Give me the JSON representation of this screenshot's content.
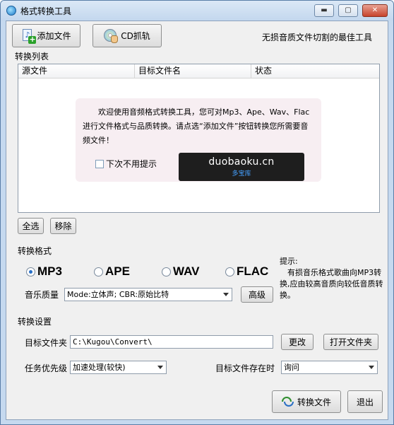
{
  "window": {
    "title": "格式转换工具",
    "controls": {
      "minimize": "▬",
      "maximize": "▢",
      "close": "✕"
    }
  },
  "toolbar": {
    "add_file_label": "添加文件",
    "cd_rip_label": "CD抓轨",
    "slogan": "无损音质文件切割的最佳工具"
  },
  "list": {
    "section_label": "转换列表",
    "columns": [
      "源文件",
      "目标文件名",
      "状态"
    ]
  },
  "welcome": {
    "message": "欢迎使用音频格式转换工具，您可对Mp3、Ape、Wav、Flac进行文件格式与品质转换。请点选“添加文件”按钮转换您所需要音频文件！",
    "dont_show_label": "下次不用提示",
    "dont_show_checked": false
  },
  "watermark": {
    "main": "duobaoku.cn",
    "sub": "多宝库"
  },
  "list_actions": {
    "select_all_label": "全选",
    "remove_label": "移除"
  },
  "format": {
    "section_label": "转换格式",
    "options": [
      {
        "label": "MP3",
        "selected": true
      },
      {
        "label": "APE",
        "selected": false
      },
      {
        "label": "WAV",
        "selected": false
      },
      {
        "label": "FLAC",
        "selected": false
      }
    ],
    "quality_label": "音乐质量",
    "quality_value": "Mode:立体声; CBR:原始比特",
    "advanced_label": "高级",
    "hint_title": "提示:",
    "hint_text": "有损音乐格式歌曲向MP3转换,应由较高音质向较低音质转换。"
  },
  "settings": {
    "section_label": "转换设置",
    "target_folder_label": "目标文件夹",
    "target_folder_value": "C:\\Kugou\\Convert\\",
    "change_label": "更改",
    "open_folder_label": "打开文件夹",
    "priority_label": "任务优先级",
    "priority_value": "加速处理(较快)",
    "exists_label": "目标文件存在时",
    "exists_value": "询问"
  },
  "footer": {
    "convert_label": "转换文件",
    "exit_label": "退出"
  }
}
